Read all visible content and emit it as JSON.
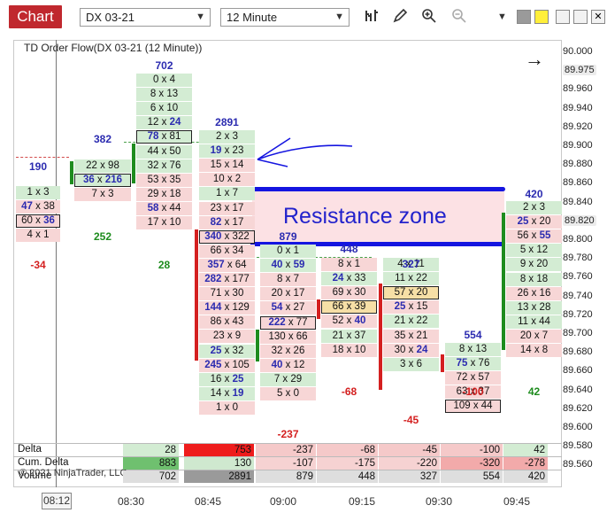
{
  "toolbar": {
    "tab_label": "Chart",
    "instrument": "DX 03-21",
    "interval": "12 Minute"
  },
  "chart": {
    "title": "TD Order Flow(DX 03-21 (12 Minute))",
    "annotation": "Resistance zone",
    "watermark": "© 2021 NinjaTrader, LLC"
  },
  "price_axis": [
    "90.000",
    "89.975",
    "89.960",
    "89.940",
    "89.920",
    "89.900",
    "89.880",
    "89.860",
    "89.840",
    "89.820",
    "89.800",
    "89.780",
    "89.760",
    "89.740",
    "89.720",
    "89.700",
    "89.680",
    "89.660",
    "89.640",
    "89.620",
    "89.600",
    "89.580",
    "89.560"
  ],
  "time_axis": {
    "cursor": "08:12",
    "labels": [
      "08:30",
      "08:45",
      "09:00",
      "09:15",
      "09:30",
      "09:45"
    ]
  },
  "bars": [
    {
      "volume": "190",
      "delta": "-34",
      "cells": [
        [
          "1 x 3",
          "g"
        ],
        [
          "47 x 38",
          "r"
        ],
        [
          "60 x 36",
          "r"
        ],
        [
          "4 x 1",
          "r"
        ]
      ]
    },
    {
      "volume": "382",
      "delta": "252",
      "cells": [
        [
          "22 x 98",
          "g"
        ],
        [
          "36 x 216",
          "g"
        ],
        [
          "7 x 3",
          "r"
        ]
      ]
    },
    {
      "volume": "702",
      "delta": "28",
      "cells": [
        [
          "0 x 4",
          "g"
        ],
        [
          "8 x 13",
          "g"
        ],
        [
          "6 x 10",
          "g"
        ],
        [
          "12 x 24",
          "g"
        ],
        [
          "78 x 81",
          "g"
        ],
        [
          "44 x 50",
          "g"
        ],
        [
          "32 x 76",
          "g"
        ],
        [
          "53 x 35",
          "r"
        ],
        [
          "29 x 18",
          "r"
        ],
        [
          "58 x 44",
          "r"
        ],
        [
          "17 x 10",
          "r"
        ]
      ]
    },
    {
      "volume": "2891",
      "delta": "-",
      "cells": [
        [
          "2 x 3",
          "g"
        ],
        [
          "19 x 23",
          "g"
        ],
        [
          "15 x 14",
          "r"
        ],
        [
          "10 x 2",
          "r"
        ],
        [
          "1 x 7",
          "g"
        ],
        [
          "23 x 17",
          "r"
        ],
        [
          "82 x 17",
          "r"
        ],
        [
          "340 x 322",
          "r"
        ],
        [
          "66 x 34",
          "r"
        ],
        [
          "357 x 64",
          "r"
        ],
        [
          "282 x 177",
          "r"
        ],
        [
          "71 x 30",
          "r"
        ],
        [
          "144 x 129",
          "r"
        ],
        [
          "86 x 43",
          "r"
        ],
        [
          "23 x 9",
          "r"
        ],
        [
          "25 x 32",
          "g"
        ],
        [
          "245 x 105",
          "r"
        ],
        [
          "16 x 25",
          "g"
        ],
        [
          "14 x 19",
          "g"
        ],
        [
          "1 x 0",
          "r"
        ]
      ]
    },
    {
      "volume": "879",
      "delta": "-237",
      "cells": [
        [
          "0 x 1",
          "g"
        ],
        [
          "40 x 59",
          "g"
        ],
        [
          "8 x 7",
          "r"
        ],
        [
          "20 x 17",
          "r"
        ],
        [
          "54 x 27",
          "r"
        ],
        [
          "222 x 77",
          "r"
        ],
        [
          "130 x 66",
          "r"
        ],
        [
          "32 x 26",
          "r"
        ],
        [
          "40 x 12",
          "r"
        ],
        [
          "7 x 29",
          "g"
        ],
        [
          "5 x 0",
          "r"
        ]
      ]
    },
    {
      "volume": "448",
      "delta": "-68",
      "cells": [
        [
          "8 x 1",
          "r"
        ],
        [
          "24 x 33",
          "g"
        ],
        [
          "69 x 30",
          "r"
        ],
        [
          "66 x 39",
          "y"
        ],
        [
          "52 x 40",
          "r"
        ],
        [
          "21 x 37",
          "g"
        ],
        [
          "18 x 10",
          "r"
        ]
      ]
    },
    {
      "volume": "327",
      "delta": "-45",
      "cells": [
        [
          "4 x 11",
          "g"
        ],
        [
          "11 x 22",
          "g"
        ],
        [
          "57 x 20",
          "y"
        ],
        [
          "25 x 15",
          "r"
        ],
        [
          "21 x 22",
          "g"
        ],
        [
          "35 x 21",
          "r"
        ],
        [
          "30 x 24",
          "r"
        ],
        [
          "3 x 6",
          "g"
        ]
      ]
    },
    {
      "volume": "554",
      "delta": "-100",
      "cells": [
        [
          "8 x 13",
          "g"
        ],
        [
          "75 x 76",
          "g"
        ],
        [
          "72 x 57",
          "r"
        ],
        [
          "63 x 37",
          "r"
        ],
        [
          "109 x 44",
          "r"
        ]
      ]
    },
    {
      "volume": "420",
      "delta": "42",
      "cells": [
        [
          "2 x 3",
          "g"
        ],
        [
          "25 x 20",
          "r"
        ],
        [
          "56 x 55",
          "r"
        ],
        [
          "5 x 12",
          "g"
        ],
        [
          "9 x 20",
          "g"
        ],
        [
          "8 x 18",
          "g"
        ],
        [
          "26 x 16",
          "r"
        ],
        [
          "13 x 28",
          "g"
        ],
        [
          "11 x 44",
          "g"
        ],
        [
          "20 x 7",
          "r"
        ],
        [
          "14 x 8",
          "r"
        ]
      ]
    }
  ],
  "stats": {
    "delta_label": "Delta",
    "cum_label": "Cum. Delta",
    "volume_label": "Volume",
    "delta": [
      "28",
      "753",
      "-237",
      "-68",
      "-45",
      "-100",
      "42"
    ],
    "cum": [
      "883",
      "130",
      "-107",
      "-175",
      "-220",
      "-320",
      "-278"
    ],
    "volume": [
      "702",
      "2891",
      "879",
      "448",
      "327",
      "554",
      "420"
    ]
  },
  "colors": {
    "up": "#1e8c1e",
    "down": "#d42020",
    "volume_text": "#2b2bb0",
    "accent": "#c0282e",
    "annotation": "#1515e0"
  }
}
